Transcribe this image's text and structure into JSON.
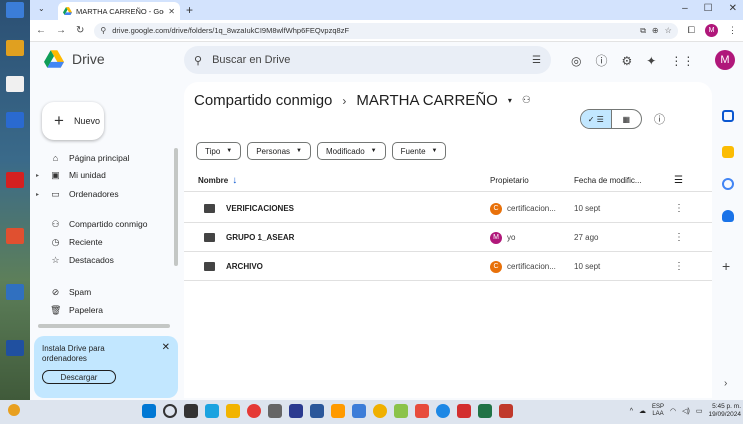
{
  "browser": {
    "tab_title": "MARTHA CARREÑO - Google D",
    "url": "drive.google.com/drive/folders/1q_8wzaIukCI9M8wlfWhp6FEQvpzq8zF",
    "profile_initial": "M"
  },
  "header": {
    "app_name": "Drive",
    "search_placeholder": "Buscar en Drive",
    "profile_initial": "M",
    "icons": [
      "tune-icon",
      "offline-icon",
      "help-icon",
      "settings-icon",
      "gemini-icon",
      "apps-icon"
    ]
  },
  "sidebar": {
    "new_label": "Nuevo",
    "items": [
      {
        "label": "Página principal",
        "icon": "home-icon"
      },
      {
        "label": "Mi unidad",
        "icon": "drive-icon"
      },
      {
        "label": "Ordenadores",
        "icon": "computer-icon"
      },
      {
        "label": "Compartido conmigo",
        "icon": "people-icon"
      },
      {
        "label": "Reciente",
        "icon": "clock-icon"
      },
      {
        "label": "Destacados",
        "icon": "star-icon"
      },
      {
        "label": "Spam",
        "icon": "spam-icon"
      },
      {
        "label": "Papelera",
        "icon": "trash-icon"
      }
    ],
    "promo": {
      "text": "Instala Drive para ordenadores",
      "button": "Descargar"
    }
  },
  "main": {
    "breadcrumb_parent": "Compartido conmigo",
    "breadcrumb_current": "MARTHA CARREÑO",
    "filters": [
      "Tipo",
      "Personas",
      "Modificado",
      "Fuente"
    ],
    "columns": {
      "name": "Nombre",
      "owner": "Propietario",
      "modified": "Fecha de modific..."
    },
    "rows": [
      {
        "name": "VERIFICACIONES",
        "owner": "certificacion...",
        "owner_initial": "C",
        "owner_color": "#e8710a",
        "date": "10 sept"
      },
      {
        "name": "GRUPO 1_ASEAR",
        "owner": "yo",
        "owner_initial": "M",
        "owner_color": "#b0177a",
        "date": "27 ago"
      },
      {
        "name": "ARCHIVO",
        "owner": "certificacion...",
        "owner_initial": "C",
        "owner_color": "#e8710a",
        "date": "10 sept"
      }
    ]
  },
  "taskbar": {
    "lang_top": "ESP",
    "lang_bottom": "LAA",
    "time": "5:45 p. m.",
    "date": "19/09/2024"
  },
  "colors": {
    "accent": "#0b57d0",
    "selected": "#c2e7ff",
    "surface": "#f8fafd"
  }
}
